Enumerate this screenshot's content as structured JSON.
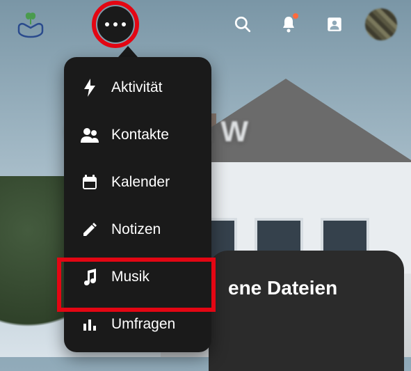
{
  "topbar": {
    "logo_name": "plant-hands-logo",
    "icons": {
      "search": "search-icon",
      "notifications": "bell-icon",
      "contacts_square": "contacts-square-icon"
    }
  },
  "background": {
    "title_line1": "G           nd W",
    "title_line2": "        "
  },
  "card": {
    "title_fragment": "ene Dateien"
  },
  "menu": {
    "items": [
      {
        "icon": "lightning-icon",
        "label": "Aktivität"
      },
      {
        "icon": "people-icon",
        "label": "Kontakte"
      },
      {
        "icon": "calendar-icon",
        "label": "Kalender"
      },
      {
        "icon": "pencil-icon",
        "label": "Notizen"
      },
      {
        "icon": "music-icon",
        "label": "Musik"
      },
      {
        "icon": "bars-icon",
        "label": "Umfragen"
      }
    ]
  },
  "annotations": {
    "circle_color": "#e30613",
    "box_color": "#e30613",
    "highlighted_menu_index": 4
  }
}
